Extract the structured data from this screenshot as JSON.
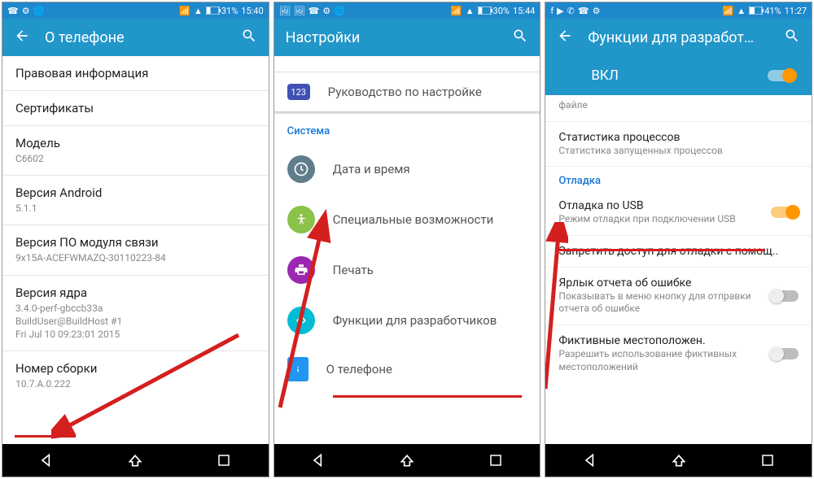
{
  "panel1": {
    "status": {
      "time": "15:40",
      "battery": "31%"
    },
    "appbar": {
      "title": "О телефоне"
    },
    "items": [
      {
        "primary": "Правовая информация"
      },
      {
        "primary": "Сертификаты"
      },
      {
        "primary": "Модель",
        "secondary": "C6602"
      },
      {
        "primary": "Версия Android",
        "secondary": "5.1.1"
      },
      {
        "primary": "Версия ПО модуля связи",
        "secondary": "9x15A-ACEFWMAZQ-30110223-84"
      },
      {
        "primary": "Версия ядра",
        "secondary": "3.4.0-perf-gbccb33a\nBuildUser@BuildHost #1\nFri Jul 10 09:23:01 2015"
      },
      {
        "primary": "Номер сборки",
        "secondary": "10.7.A.0.222"
      }
    ]
  },
  "panel2": {
    "status": {
      "time": "15:44",
      "battery": "30%"
    },
    "appbar": {
      "title": "Настройки"
    },
    "guide": {
      "label": "Руководство по настройке",
      "icon_text": "123"
    },
    "section": "Система",
    "items": [
      {
        "label": "Дата и время",
        "color": "#607D8B",
        "glyph": "clock"
      },
      {
        "label": "Специальные возможности",
        "color": "#8BC34A",
        "glyph": "a11y"
      },
      {
        "label": "Печать",
        "color": "#9C27B0",
        "glyph": "print"
      },
      {
        "label": "Функции для разработчиков",
        "color": "#00BCD4",
        "glyph": "dev"
      },
      {
        "label": "О телефоне",
        "color": "#2196F3",
        "glyph": "info",
        "square": true
      }
    ]
  },
  "panel3": {
    "status": {
      "time": "11:27",
      "battery": "41%"
    },
    "appbar": {
      "title": "Функции для разработ…"
    },
    "master": {
      "label": "ВКЛ"
    },
    "partial_top": "файле",
    "stats": {
      "primary": "Статистика процессов",
      "secondary": "Статистика запущенных процессов"
    },
    "section": "Отладка",
    "items": [
      {
        "primary": "Отладка по USB",
        "secondary": "Режим отладки при подключении USB",
        "switch": "on"
      },
      {
        "primary": "Запретить доступ для отладки с помощ.."
      },
      {
        "primary": "Ярлык отчета об ошибке",
        "secondary": "Показывать в меню кнопку для отправки отчета об ошибке",
        "switch": "off"
      },
      {
        "primary": "Фиктивные местоположен.",
        "secondary": "Разрешить использование фиктивных местоположений",
        "switch": "off"
      }
    ]
  }
}
